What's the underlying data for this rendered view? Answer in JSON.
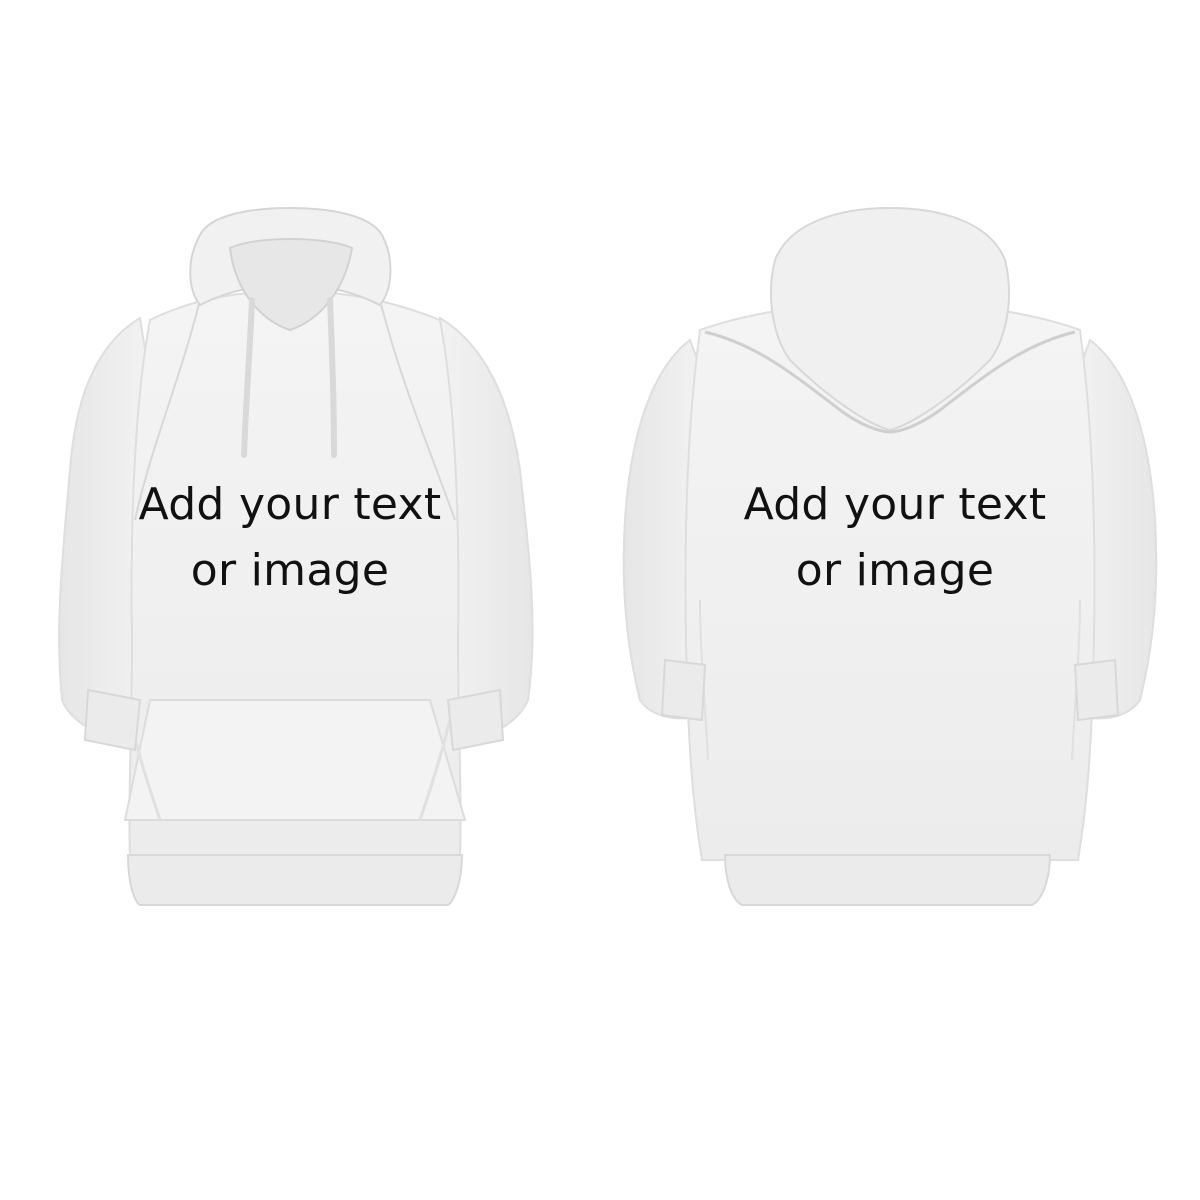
{
  "front": {
    "line1": "Add your text",
    "line2": "or image"
  },
  "back": {
    "line1": "Add your text",
    "line2": "or image"
  },
  "colors": {
    "background": "#ffffff",
    "fabric": "#f0f0f0",
    "fabric_shadow": "#dcdcdc",
    "text": "#111111"
  }
}
